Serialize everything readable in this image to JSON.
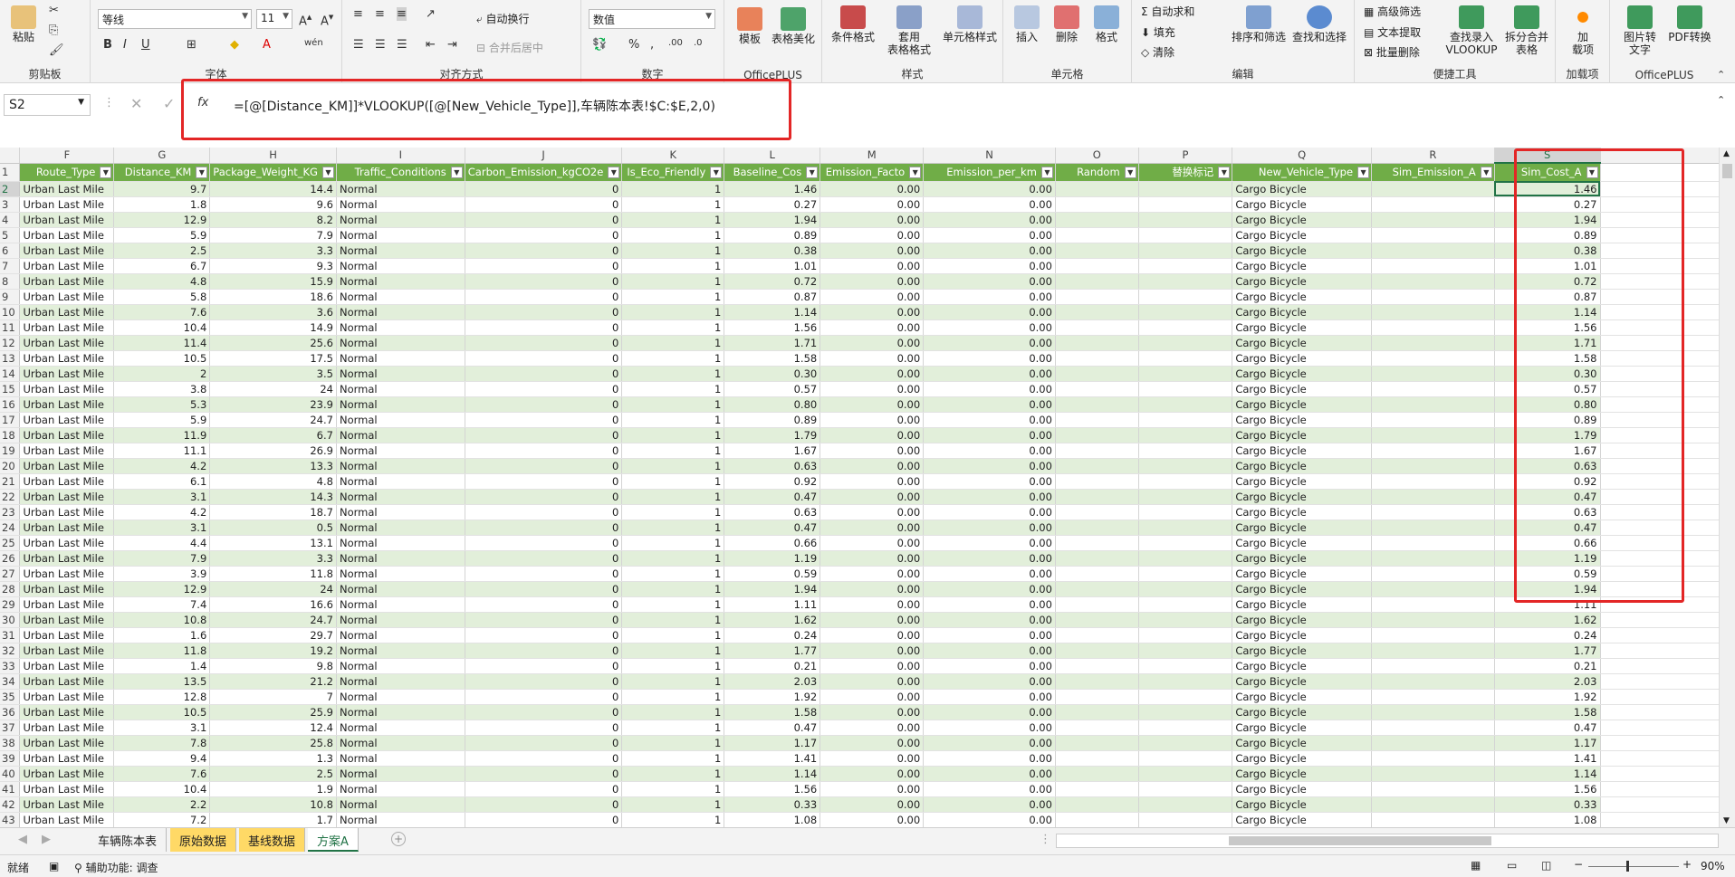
{
  "ribbon": {
    "clipboard": {
      "paste": "粘贴",
      "label": "剪贴板"
    },
    "font": {
      "name": "等线",
      "size": "11",
      "label": "字体"
    },
    "align": {
      "wrap": "自动换行",
      "merge": "合并后居中",
      "label": "对齐方式"
    },
    "number": {
      "format": "数值",
      "label": "数字"
    },
    "officeplus1": {
      "template": "模板",
      "beautify": "表格美化",
      "label": "OfficePLUS"
    },
    "styles": {
      "cond": "条件格式",
      "table1": "套用",
      "table2": "表格格式",
      "cell1": "单元格样式",
      "label": "样式"
    },
    "cells": {
      "insert": "插入",
      "delete": "删除",
      "format": "格式",
      "label": "单元格"
    },
    "edit": {
      "autosum": "自动求和",
      "fill": "填充",
      "clear": "清除",
      "sort": "排序和筛选",
      "find": "查找和选择",
      "label": "编辑"
    },
    "tools": {
      "adv": "高级筛选",
      "text": "文本提取",
      "batch": "批量删除",
      "lookup1": "查找录入",
      "lookup2": "VLOOKUP",
      "split1": "拆分合并",
      "split2": "表格",
      "label": "便捷工具"
    },
    "addin": {
      "add1": "加",
      "add2": "载项",
      "label": "加载项"
    },
    "officeplus2": {
      "img1": "图片转",
      "img2": "文字",
      "pdf": "PDF转换",
      "label": "OfficePLUS"
    }
  },
  "formula_bar": {
    "name_box": "S2",
    "fx": "fx",
    "formula": "=[@[Distance_KM]]*VLOOKUP([@[New_Vehicle_Type]],车辆陈本表!$C:$E,2,0)"
  },
  "columns": [
    "F",
    "G",
    "H",
    "I",
    "J",
    "K",
    "L",
    "M",
    "N",
    "O",
    "P",
    "Q",
    "R",
    "S"
  ],
  "headers": [
    "Route_Type",
    "Distance_KM",
    "Package_Weight_KG",
    "Traffic_Conditions",
    "Carbon_Emission_kgCO2e",
    "Is_Eco_Friendly",
    "Baseline_Cos",
    "Emission_Facto",
    "Emission_per_km",
    "Random",
    "替换标记",
    "New_Vehicle_Type",
    "Sim_Emission_A",
    "Sim_Cost_A"
  ],
  "rows": [
    [
      "9.7",
      "14.4",
      "1.46"
    ],
    [
      "1.8",
      "9.6",
      "0.27"
    ],
    [
      "12.9",
      "8.2",
      "1.94"
    ],
    [
      "5.9",
      "7.9",
      "0.89"
    ],
    [
      "2.5",
      "3.3",
      "0.38"
    ],
    [
      "6.7",
      "9.3",
      "1.01"
    ],
    [
      "4.8",
      "15.9",
      "0.72"
    ],
    [
      "5.8",
      "18.6",
      "0.87"
    ],
    [
      "7.6",
      "3.6",
      "1.14"
    ],
    [
      "10.4",
      "14.9",
      "1.56"
    ],
    [
      "11.4",
      "25.6",
      "1.71"
    ],
    [
      "10.5",
      "17.5",
      "1.58"
    ],
    [
      "2",
      "3.5",
      "0.30"
    ],
    [
      "3.8",
      "24",
      "0.57"
    ],
    [
      "5.3",
      "23.9",
      "0.80"
    ],
    [
      "5.9",
      "24.7",
      "0.89"
    ],
    [
      "11.9",
      "6.7",
      "1.79"
    ],
    [
      "11.1",
      "26.9",
      "1.67"
    ],
    [
      "4.2",
      "13.3",
      "0.63"
    ],
    [
      "6.1",
      "4.8",
      "0.92"
    ],
    [
      "3.1",
      "14.3",
      "0.47"
    ],
    [
      "4.2",
      "18.7",
      "0.63"
    ],
    [
      "3.1",
      "0.5",
      "0.47"
    ],
    [
      "4.4",
      "13.1",
      "0.66"
    ],
    [
      "7.9",
      "3.3",
      "1.19"
    ],
    [
      "3.9",
      "11.8",
      "0.59"
    ],
    [
      "12.9",
      "24",
      "1.94"
    ],
    [
      "7.4",
      "16.6",
      "1.11"
    ],
    [
      "10.8",
      "24.7",
      "1.62"
    ],
    [
      "1.6",
      "29.7",
      "0.24"
    ],
    [
      "11.8",
      "19.2",
      "1.77"
    ],
    [
      "1.4",
      "9.8",
      "0.21"
    ],
    [
      "13.5",
      "21.2",
      "2.03"
    ],
    [
      "12.8",
      "7",
      "1.92"
    ],
    [
      "10.5",
      "25.9",
      "1.58"
    ],
    [
      "3.1",
      "12.4",
      "0.47"
    ],
    [
      "7.8",
      "25.8",
      "1.17"
    ],
    [
      "9.4",
      "1.3",
      "1.41"
    ],
    [
      "7.6",
      "2.5",
      "1.14"
    ],
    [
      "10.4",
      "1.9",
      "1.56"
    ],
    [
      "2.2",
      "10.8",
      "0.33"
    ],
    [
      "7.2",
      "1.7",
      "1.08"
    ]
  ],
  "constants": {
    "route": "Urban Last Mile",
    "traffic": "Normal",
    "carbon": "0",
    "eco": "1",
    "zero": "0.00",
    "vehicle": "Cargo Bicycle"
  },
  "tabs": [
    "车辆陈本表",
    "原始数据",
    "基线数据",
    "方案A"
  ],
  "status": {
    "ready": "就绪",
    "accessibility": "辅助功能: 调查",
    "zoom": "90%"
  }
}
